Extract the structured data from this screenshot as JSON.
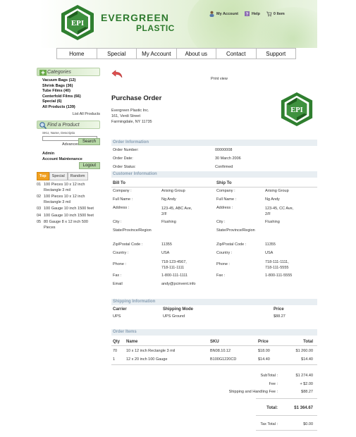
{
  "header": {
    "brand_line1": "EVERGREEN",
    "brand_line2": "PLASTIC",
    "logo_text": "EPI",
    "links": [
      {
        "label": "My Account",
        "icon": "user-icon"
      },
      {
        "label": "Help",
        "icon": "help-icon"
      },
      {
        "label": "0 Item",
        "icon": "cart-icon"
      }
    ]
  },
  "nav": [
    "Home",
    "Special",
    "My Account",
    "About us",
    "Contact",
    "Support"
  ],
  "sidebar": {
    "categories_title": "Categories",
    "categories": [
      "Vacuum Bags (12)",
      "Shrink Bags (36)",
      "Tube Films (40)",
      "Centerfold Films (66)",
      "Special (6)",
      "All Products (139)"
    ],
    "list_all": "List All Products",
    "find_title": "Find a Product",
    "search_label": "SKU, Name, Descriptio",
    "advanced": "Advanced Search",
    "search_btn": "Search",
    "admin": "Admin",
    "account_maintenance": "Account Maintenance",
    "logout": "Logout",
    "tabs": [
      "Top",
      "Special",
      "Random"
    ],
    "top_items": [
      {
        "n": "01",
        "text": "100 Pieces 10 x 12 inch Rectangle 3 mil"
      },
      {
        "n": "02",
        "text": "100 Pieces 10 x 12 inch Rectangle 3 mil"
      },
      {
        "n": "03",
        "text": "100 Gauge 10 inch 1500 feet"
      },
      {
        "n": "04",
        "text": "100 Gauge 10 inch 1500 feet"
      },
      {
        "n": "05",
        "text": "80 Gauge 8 x 12 inch 500 Pieces"
      }
    ]
  },
  "main": {
    "print_view": "Print view",
    "title": "Purchase Order",
    "company": "Evergreen Plastic Inc.",
    "street": "161, Verdi Street",
    "city": "Farmingdale, NY 11735",
    "order_info_title": "Order Information",
    "order_number_label": "Order Number:",
    "order_number": "00000008",
    "order_date_label": "Order Date:",
    "order_date": "30 March 2006",
    "order_status_label": "Order Status:",
    "order_status": "Confirmed",
    "customer_info_title": "Customer Information",
    "bill_to": "Bill To",
    "ship_to": "Ship To",
    "labels": {
      "company": "Company :",
      "full_name": "Full Name :",
      "address": "Address :",
      "city": "City :",
      "state": "State/Province/Region",
      "zip": "Zip/Postal Code :",
      "country": "Country :",
      "phone": "Phone :",
      "fax": "Fax :",
      "email": "Email"
    },
    "bill": {
      "company": "Arising Group",
      "full_name": "Ng Andy",
      "address1": "123-45, ABC Ave,",
      "address2": "2/F",
      "city": "Flushing",
      "zip": "11355",
      "country": "USA",
      "phone1": "718-123-4567,",
      "phone2": "718-111-1111",
      "fax": "1-800-111-1111",
      "email": "andy@pcinvent.info"
    },
    "ship": {
      "company": "Arising Group",
      "full_name": "Ng Andy",
      "address1": "123-45, CC Ave,",
      "address2": "2/F",
      "city": "Flushing",
      "zip": "11355",
      "country": "USA",
      "phone1": "718-111-1111,",
      "phone2": "718-111-5555",
      "fax": "1-800-111-5555"
    },
    "shipping_title": "Shipping Information",
    "carrier_label": "Carrier",
    "mode_label": "Shipping Mode",
    "price_label": "Price",
    "carrier": "UPS",
    "mode": "UPS Ground",
    "ship_price": "$88.27",
    "items_title": "Order Items",
    "items_headers": {
      "qty": "Qty",
      "name": "Name",
      "sku": "SKU",
      "price": "Price",
      "total": "Total"
    },
    "items": [
      {
        "qty": "70",
        "name": "10 x 12 inch Rectangle 3 mil",
        "sku": "BN08.10.12",
        "price": "$18.00",
        "total": "$1 260.00"
      },
      {
        "qty": "1",
        "name": "12 x 20 inch 100 Gauge",
        "sku": "B100G1220CD",
        "price": "$14.40",
        "total": "$14.40"
      }
    ],
    "subtotal_label": "SubTotal :",
    "subtotal": "$1 274.40",
    "fee_label": "Fee :",
    "fee": "+ $2.00",
    "shipping_fee_label": "Shipping and Handling Fee :",
    "shipping_fee": "$88.27",
    "total_label": "Total:",
    "total": "$1 364.67",
    "tax_label": "Tax Total :",
    "tax": "$0.00"
  }
}
